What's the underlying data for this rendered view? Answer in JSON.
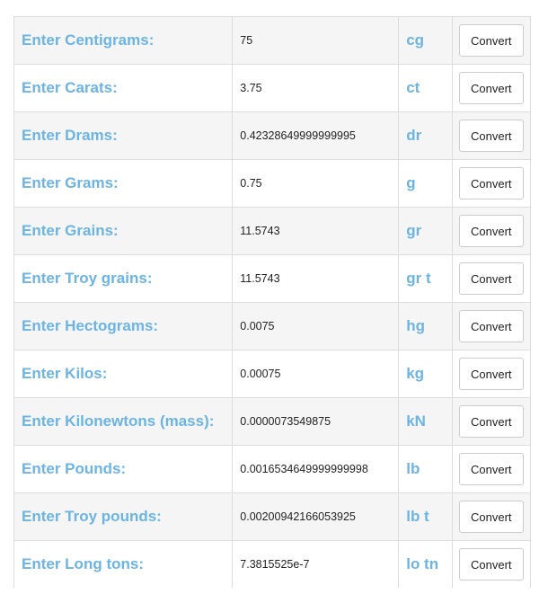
{
  "button_label": "Convert",
  "rows": [
    {
      "label": "Enter Centigrams:",
      "value": "75",
      "unit": "cg"
    },
    {
      "label": "Enter Carats:",
      "value": "3.75",
      "unit": "ct"
    },
    {
      "label": "Enter Drams:",
      "value": "0.42328649999999995",
      "unit": "dr"
    },
    {
      "label": "Enter Grams:",
      "value": "0.75",
      "unit": "g"
    },
    {
      "label": "Enter Grains:",
      "value": "11.5743",
      "unit": "gr"
    },
    {
      "label": "Enter Troy grains:",
      "value": "11.5743",
      "unit": "gr t"
    },
    {
      "label": "Enter Hectograms:",
      "value": "0.0075",
      "unit": "hg"
    },
    {
      "label": "Enter Kilos:",
      "value": "0.00075",
      "unit": "kg"
    },
    {
      "label": "Enter Kilonewtons (mass):",
      "value": "0.0000073549875",
      "unit": "kN"
    },
    {
      "label": "Enter Pounds:",
      "value": "0.0016534649999999998",
      "unit": "lb"
    },
    {
      "label": "Enter Troy pounds:",
      "value": "0.00200942166053925",
      "unit": "lb t"
    },
    {
      "label": "Enter Long tons:",
      "value": "7.3815525e-7",
      "unit": "lo tn"
    }
  ]
}
